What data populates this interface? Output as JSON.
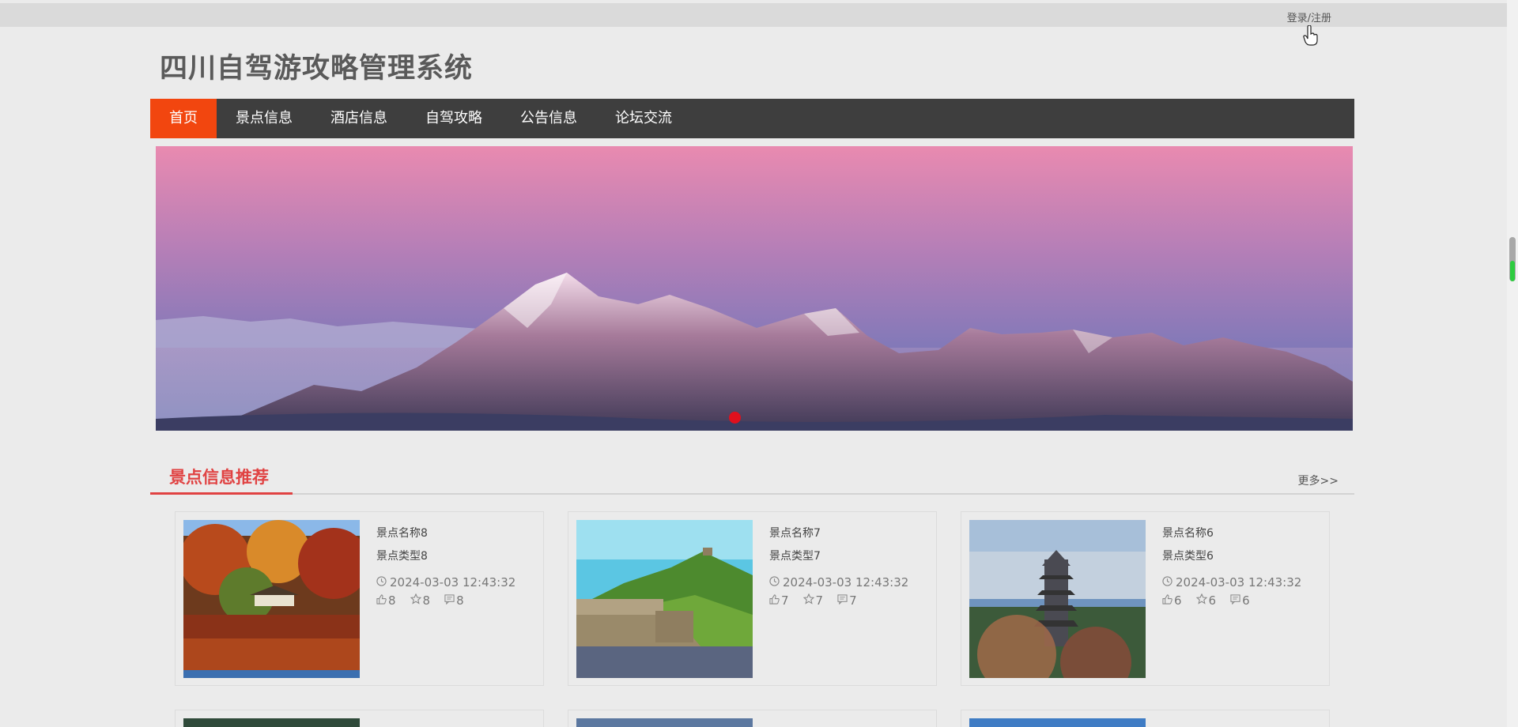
{
  "header": {
    "login_register": "登录/注册",
    "site_title": "四川自驾游攻略管理系统"
  },
  "nav": {
    "items": [
      "首页",
      "景点信息",
      "酒店信息",
      "自驾攻略",
      "公告信息",
      "论坛交流"
    ],
    "active_index": 0
  },
  "banner": {
    "slide_count": 1,
    "active_slide": 1
  },
  "section": {
    "title": "景点信息推荐",
    "more": "更多>>"
  },
  "cards": [
    {
      "name": "景点名称8",
      "type": "景点类型8",
      "time": "2024-03-03 12:43:32",
      "likes": "8",
      "favorites": "8",
      "comments": "8"
    },
    {
      "name": "景点名称7",
      "type": "景点类型7",
      "time": "2024-03-03 12:43:32",
      "likes": "7",
      "favorites": "7",
      "comments": "7"
    },
    {
      "name": "景点名称6",
      "type": "景点类型6",
      "time": "2024-03-03 12:43:32",
      "likes": "6",
      "favorites": "6",
      "comments": "6"
    }
  ],
  "colors": {
    "nav_bg": "#3e3e3e",
    "nav_active": "#f2460f",
    "section_accent": "#e04242",
    "banner_dot": "#e0101d"
  },
  "icons": [
    "clock-icon",
    "thumbs-up-icon",
    "star-icon",
    "comment-icon",
    "hand-pointer-icon"
  ]
}
